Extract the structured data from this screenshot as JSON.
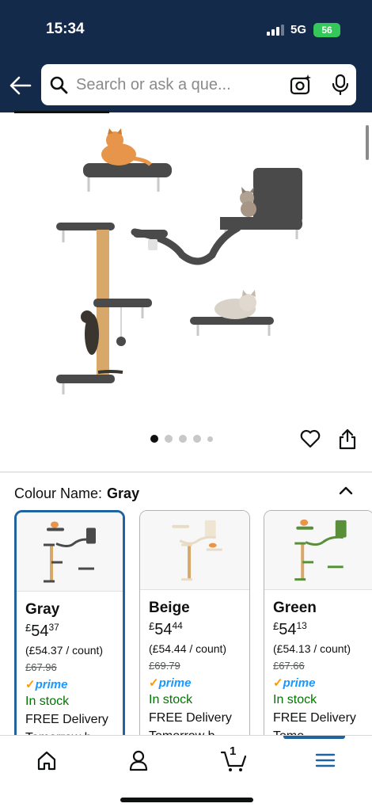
{
  "status_bar": {
    "time": "15:34",
    "network": "5G",
    "battery": "56"
  },
  "search": {
    "placeholder": "Search or ask a que..."
  },
  "colours": {
    "heading_label": "Colour Name:",
    "selected": "Gray",
    "options": [
      {
        "name": "Gray",
        "currency": "£",
        "price_whole": "54",
        "price_fraction": "37",
        "unit_price": "(£54.37 / count)",
        "was_price": "£67.96",
        "prime": "prime",
        "stock": "In stock",
        "delivery": "FREE Delivery",
        "more": "Tomorrow b..."
      },
      {
        "name": "Beige",
        "currency": "£",
        "price_whole": "54",
        "price_fraction": "44",
        "unit_price": "(£54.44 / count)",
        "was_price": "£69.79",
        "prime": "prime",
        "stock": "In stock",
        "delivery": "FREE Delivery",
        "more": "Tomorrow b..."
      },
      {
        "name": "Green",
        "currency": "£",
        "price_whole": "54",
        "price_fraction": "13",
        "unit_price": "(£54.13 / count)",
        "was_price": "£67.66",
        "prime": "prime",
        "stock": "In stock",
        "delivery": "FREE Delivery",
        "more": "Tomo..."
      }
    ]
  },
  "gallery": {
    "image_count": 5,
    "active_index": 0
  },
  "nav": {
    "cart_count": "1"
  },
  "colors": {
    "header_bg": "#132a4b",
    "accent": "#2162a1",
    "stock_green": "#007600",
    "prime_blue": "#1a98ff"
  }
}
